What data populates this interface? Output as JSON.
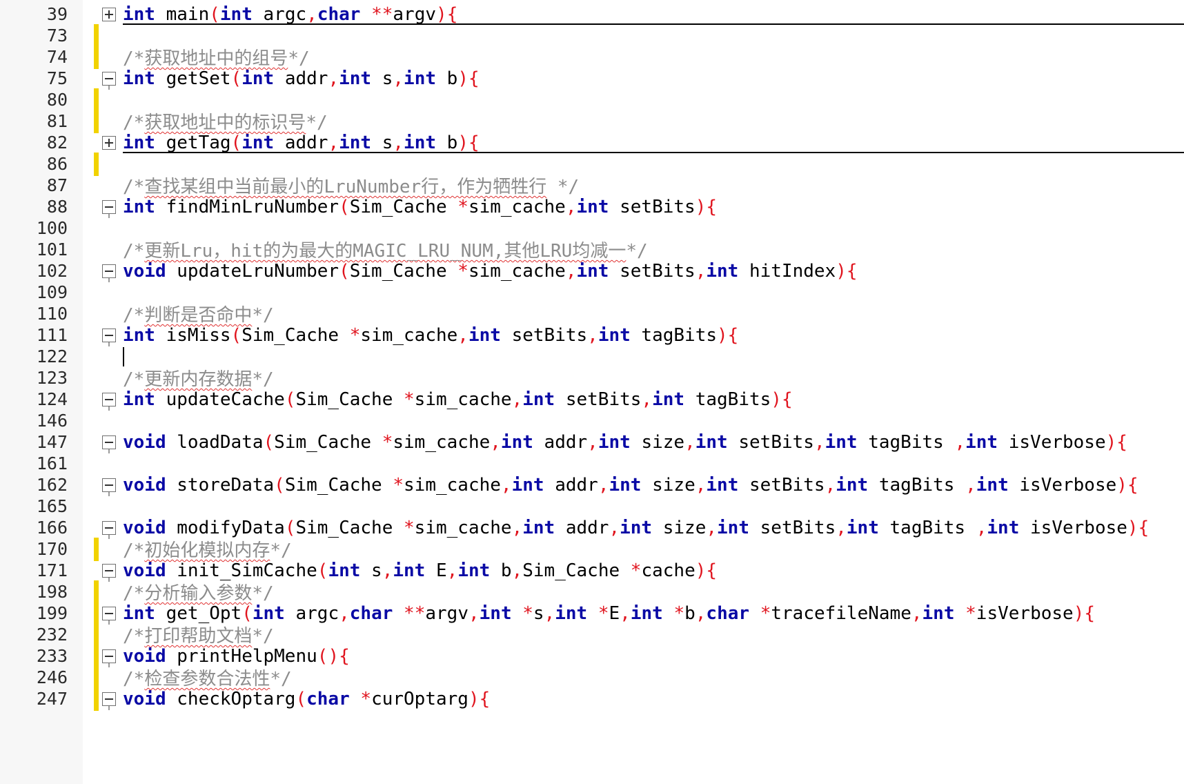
{
  "editor": {
    "colors": {
      "keyword": "#0a0aa5",
      "punctuation": "#e0141e",
      "comment": "#8c8c8c",
      "change_bar": "#f1d200",
      "spell_underline": "#e03030"
    },
    "lines": [
      {
        "n": "39",
        "bar": false,
        "fold": "plus",
        "sep": true,
        "tokens": [
          [
            "kw",
            "int"
          ],
          [
            "t",
            " main"
          ],
          [
            "p",
            "("
          ],
          [
            "kw",
            "int"
          ],
          [
            "t",
            " argc"
          ],
          [
            "p",
            ","
          ],
          [
            "kw",
            "char"
          ],
          [
            "t",
            " "
          ],
          [
            "p",
            "**"
          ],
          [
            "t",
            "argv"
          ],
          [
            "p",
            ")"
          ],
          [
            "p",
            "{"
          ]
        ]
      },
      {
        "n": "73",
        "bar": true
      },
      {
        "n": "74",
        "bar": true,
        "comment": {
          "open": "/*",
          "text": "获取地址中的组号",
          "close": "*/"
        }
      },
      {
        "n": "75",
        "bar": false,
        "fold": "minus",
        "tokens": [
          [
            "kw",
            "int"
          ],
          [
            "t",
            " getSet"
          ],
          [
            "p",
            "("
          ],
          [
            "kw",
            "int"
          ],
          [
            "t",
            " addr"
          ],
          [
            "p",
            ","
          ],
          [
            "kw",
            "int"
          ],
          [
            "t",
            " s"
          ],
          [
            "p",
            ","
          ],
          [
            "kw",
            "int"
          ],
          [
            "t",
            " b"
          ],
          [
            "p",
            ")"
          ],
          [
            "p",
            "{"
          ]
        ]
      },
      {
        "n": "80",
        "bar": true
      },
      {
        "n": "81",
        "bar": true,
        "comment": {
          "open": "/*",
          "text": "获取地址中的标识号",
          "close": "*/"
        }
      },
      {
        "n": "82",
        "bar": false,
        "fold": "plus",
        "sep": true,
        "tokens": [
          [
            "kw",
            "int"
          ],
          [
            "t",
            " getTag"
          ],
          [
            "p",
            "("
          ],
          [
            "kw",
            "int"
          ],
          [
            "t",
            " addr"
          ],
          [
            "p",
            ","
          ],
          [
            "kw",
            "int"
          ],
          [
            "t",
            " s"
          ],
          [
            "p",
            ","
          ],
          [
            "kw",
            "int"
          ],
          [
            "t",
            " b"
          ],
          [
            "p",
            ")"
          ],
          [
            "p",
            "{"
          ]
        ]
      },
      {
        "n": "86",
        "bar": true
      },
      {
        "n": "87",
        "bar": false,
        "comment": {
          "open": "/*",
          "text": "查找某组中当前最小的LruNumber行，作为牺牲行",
          "close": " */"
        }
      },
      {
        "n": "88",
        "bar": false,
        "fold": "minus",
        "tokens": [
          [
            "kw",
            "int"
          ],
          [
            "t",
            " findMinLruNumber"
          ],
          [
            "p",
            "("
          ],
          [
            "t",
            "Sim_Cache "
          ],
          [
            "p",
            "*"
          ],
          [
            "t",
            "sim_cache"
          ],
          [
            "p",
            ","
          ],
          [
            "kw",
            "int"
          ],
          [
            "t",
            " setBits"
          ],
          [
            "p",
            ")"
          ],
          [
            "p",
            "{"
          ]
        ]
      },
      {
        "n": "100",
        "bar": false
      },
      {
        "n": "101",
        "bar": false,
        "comment": {
          "open": "/*",
          "text": "更新Lru，hit的为最大的MAGIC_LRU_NUM,其他LRU均减一",
          "close": "*/"
        }
      },
      {
        "n": "102",
        "bar": false,
        "fold": "minus",
        "tokens": [
          [
            "kw",
            "void"
          ],
          [
            "t",
            " updateLruNumber"
          ],
          [
            "p",
            "("
          ],
          [
            "t",
            "Sim_Cache "
          ],
          [
            "p",
            "*"
          ],
          [
            "t",
            "sim_cache"
          ],
          [
            "p",
            ","
          ],
          [
            "kw",
            "int"
          ],
          [
            "t",
            " setBits"
          ],
          [
            "p",
            ","
          ],
          [
            "kw",
            "int"
          ],
          [
            "t",
            " hitIndex"
          ],
          [
            "p",
            ")"
          ],
          [
            "p",
            "{"
          ]
        ]
      },
      {
        "n": "109",
        "bar": false
      },
      {
        "n": "110",
        "bar": false,
        "comment": {
          "open": "/*",
          "text": "判断是否命中",
          "close": "*/"
        }
      },
      {
        "n": "111",
        "bar": false,
        "fold": "minus",
        "tokens": [
          [
            "kw",
            "int"
          ],
          [
            "t",
            " isMiss"
          ],
          [
            "p",
            "("
          ],
          [
            "t",
            "Sim_Cache "
          ],
          [
            "p",
            "*"
          ],
          [
            "t",
            "sim_cache"
          ],
          [
            "p",
            ","
          ],
          [
            "kw",
            "int"
          ],
          [
            "t",
            " setBits"
          ],
          [
            "p",
            ","
          ],
          [
            "kw",
            "int"
          ],
          [
            "t",
            " tagBits"
          ],
          [
            "p",
            ")"
          ],
          [
            "p",
            "{"
          ]
        ]
      },
      {
        "n": "122",
        "bar": false,
        "caret": true
      },
      {
        "n": "123",
        "bar": false,
        "comment": {
          "open": "/*",
          "text": "更新内存数据",
          "close": "*/"
        }
      },
      {
        "n": "124",
        "bar": false,
        "fold": "minus",
        "tokens": [
          [
            "kw",
            "int"
          ],
          [
            "t",
            " updateCache"
          ],
          [
            "p",
            "("
          ],
          [
            "t",
            "Sim_Cache "
          ],
          [
            "p",
            "*"
          ],
          [
            "t",
            "sim_cache"
          ],
          [
            "p",
            ","
          ],
          [
            "kw",
            "int"
          ],
          [
            "t",
            " setBits"
          ],
          [
            "p",
            ","
          ],
          [
            "kw",
            "int"
          ],
          [
            "t",
            " tagBits"
          ],
          [
            "p",
            ")"
          ],
          [
            "p",
            "{"
          ]
        ]
      },
      {
        "n": "146",
        "bar": false
      },
      {
        "n": "147",
        "bar": false,
        "fold": "minus",
        "tokens": [
          [
            "kw",
            "void"
          ],
          [
            "t",
            " loadData"
          ],
          [
            "p",
            "("
          ],
          [
            "t",
            "Sim_Cache "
          ],
          [
            "p",
            "*"
          ],
          [
            "t",
            "sim_cache"
          ],
          [
            "p",
            ","
          ],
          [
            "kw",
            "int"
          ],
          [
            "t",
            " addr"
          ],
          [
            "p",
            ","
          ],
          [
            "kw",
            "int"
          ],
          [
            "t",
            " size"
          ],
          [
            "p",
            ","
          ],
          [
            "kw",
            "int"
          ],
          [
            "t",
            " setBits"
          ],
          [
            "p",
            ","
          ],
          [
            "kw",
            "int"
          ],
          [
            "t",
            " tagBits "
          ],
          [
            "p",
            ","
          ],
          [
            "kw",
            "int"
          ],
          [
            "t",
            " isVerbose"
          ],
          [
            "p",
            ")"
          ],
          [
            "p",
            "{"
          ]
        ]
      },
      {
        "n": "161",
        "bar": false
      },
      {
        "n": "162",
        "bar": false,
        "fold": "minus",
        "tokens": [
          [
            "kw",
            "void"
          ],
          [
            "t",
            " storeData"
          ],
          [
            "p",
            "("
          ],
          [
            "t",
            "Sim_Cache "
          ],
          [
            "p",
            "*"
          ],
          [
            "t",
            "sim_cache"
          ],
          [
            "p",
            ","
          ],
          [
            "kw",
            "int"
          ],
          [
            "t",
            " addr"
          ],
          [
            "p",
            ","
          ],
          [
            "kw",
            "int"
          ],
          [
            "t",
            " size"
          ],
          [
            "p",
            ","
          ],
          [
            "kw",
            "int"
          ],
          [
            "t",
            " setBits"
          ],
          [
            "p",
            ","
          ],
          [
            "kw",
            "int"
          ],
          [
            "t",
            " tagBits "
          ],
          [
            "p",
            ","
          ],
          [
            "kw",
            "int"
          ],
          [
            "t",
            " isVerbose"
          ],
          [
            "p",
            ")"
          ],
          [
            "p",
            "{"
          ]
        ]
      },
      {
        "n": "165",
        "bar": false
      },
      {
        "n": "166",
        "bar": false,
        "fold": "minus",
        "tokens": [
          [
            "kw",
            "void"
          ],
          [
            "t",
            " modifyData"
          ],
          [
            "p",
            "("
          ],
          [
            "t",
            "Sim_Cache "
          ],
          [
            "p",
            "*"
          ],
          [
            "t",
            "sim_cache"
          ],
          [
            "p",
            ","
          ],
          [
            "kw",
            "int"
          ],
          [
            "t",
            " addr"
          ],
          [
            "p",
            ","
          ],
          [
            "kw",
            "int"
          ],
          [
            "t",
            " size"
          ],
          [
            "p",
            ","
          ],
          [
            "kw",
            "int"
          ],
          [
            "t",
            " setBits"
          ],
          [
            "p",
            ","
          ],
          [
            "kw",
            "int"
          ],
          [
            "t",
            " tagBits "
          ],
          [
            "p",
            ","
          ],
          [
            "kw",
            "int"
          ],
          [
            "t",
            " isVerbose"
          ],
          [
            "p",
            ")"
          ],
          [
            "p",
            "{"
          ]
        ]
      },
      {
        "n": "170",
        "bar": true,
        "comment": {
          "open": "/*",
          "text": "初始化模拟内存",
          "close": "*/"
        }
      },
      {
        "n": "171",
        "bar": false,
        "fold": "minus",
        "tokens": [
          [
            "kw",
            "void"
          ],
          [
            "t",
            " init_SimCache"
          ],
          [
            "p",
            "("
          ],
          [
            "kw",
            "int"
          ],
          [
            "t",
            " s"
          ],
          [
            "p",
            ","
          ],
          [
            "kw",
            "int"
          ],
          [
            "t",
            " E"
          ],
          [
            "p",
            ","
          ],
          [
            "kw",
            "int"
          ],
          [
            "t",
            " b"
          ],
          [
            "p",
            ","
          ],
          [
            "t",
            "Sim_Cache "
          ],
          [
            "p",
            "*"
          ],
          [
            "t",
            "cache"
          ],
          [
            "p",
            ")"
          ],
          [
            "p",
            "{"
          ]
        ]
      },
      {
        "n": "198",
        "bar": true,
        "comment": {
          "open": "/*",
          "text": "分析输入参数",
          "close": "*/"
        }
      },
      {
        "n": "199",
        "bar": true,
        "fold": "minus",
        "tokens": [
          [
            "kw",
            "int"
          ],
          [
            "t",
            " get_Opt"
          ],
          [
            "p",
            "("
          ],
          [
            "kw",
            "int"
          ],
          [
            "t",
            " argc"
          ],
          [
            "p",
            ","
          ],
          [
            "kw",
            "char"
          ],
          [
            "t",
            " "
          ],
          [
            "p",
            "**"
          ],
          [
            "t",
            "argv"
          ],
          [
            "p",
            ","
          ],
          [
            "kw",
            "int"
          ],
          [
            "t",
            " "
          ],
          [
            "p",
            "*"
          ],
          [
            "t",
            "s"
          ],
          [
            "p",
            ","
          ],
          [
            "kw",
            "int"
          ],
          [
            "t",
            " "
          ],
          [
            "p",
            "*"
          ],
          [
            "t",
            "E"
          ],
          [
            "p",
            ","
          ],
          [
            "kw",
            "int"
          ],
          [
            "t",
            " "
          ],
          [
            "p",
            "*"
          ],
          [
            "t",
            "b"
          ],
          [
            "p",
            ","
          ],
          [
            "kw",
            "char"
          ],
          [
            "t",
            " "
          ],
          [
            "p",
            "*"
          ],
          [
            "t",
            "tracefileName"
          ],
          [
            "p",
            ","
          ],
          [
            "kw",
            "int"
          ],
          [
            "t",
            " "
          ],
          [
            "p",
            "*"
          ],
          [
            "t",
            "isVerbose"
          ],
          [
            "p",
            ")"
          ],
          [
            "p",
            "{"
          ]
        ]
      },
      {
        "n": "232",
        "bar": true,
        "comment": {
          "open": "/*",
          "text": "打印帮助文档",
          "close": "*/"
        }
      },
      {
        "n": "233",
        "bar": true,
        "fold": "minus",
        "tokens": [
          [
            "kw",
            "void"
          ],
          [
            "t",
            " printHelpMenu"
          ],
          [
            "p",
            "("
          ],
          [
            "p",
            ")"
          ],
          [
            "p",
            "{"
          ]
        ]
      },
      {
        "n": "246",
        "bar": true,
        "comment": {
          "open": "/*",
          "text": "检查参数合法性",
          "close": "*/"
        }
      },
      {
        "n": "247",
        "bar": true,
        "fold": "minus",
        "tokens": [
          [
            "kw",
            "void"
          ],
          [
            "t",
            " checkOptarg"
          ],
          [
            "p",
            "("
          ],
          [
            "kw",
            "char"
          ],
          [
            "t",
            " "
          ],
          [
            "p",
            "*"
          ],
          [
            "t",
            "curOptarg"
          ],
          [
            "p",
            ")"
          ],
          [
            "p",
            "{"
          ]
        ]
      }
    ]
  }
}
